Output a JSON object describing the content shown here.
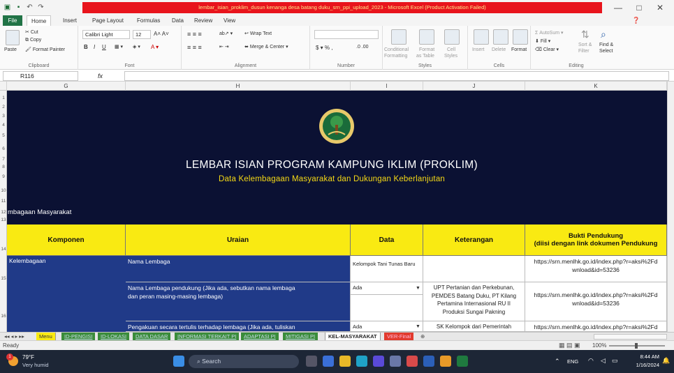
{
  "window": {
    "title": "lembar_isian_proklim_dusun kenanga desa batang duku_srn_ppi_upload_2023 - Microsoft Excel (Product Activation Failed)",
    "controls": [
      "—",
      "□",
      "✕"
    ]
  },
  "ribbon_tabs": [
    "File",
    "Home",
    "Insert",
    "Page Layout",
    "Formulas",
    "Data",
    "Review",
    "View"
  ],
  "ribbon": {
    "clipboard": {
      "paste": "Paste",
      "cut": "Cut",
      "copy": "Copy",
      "format_painter": "Format Painter",
      "label": "Clipboard"
    },
    "font": {
      "name": "Calibri Light",
      "size": "12",
      "label": "Font",
      "bold": "B",
      "italic": "I",
      "underline": "U"
    },
    "alignment": {
      "wrap": "Wrap Text",
      "merge": "Merge & Center",
      "label": "Alignment"
    },
    "number": {
      "label": "Number",
      "currency": "$",
      "percent": "%",
      "comma": ","
    },
    "styles": {
      "conditional": "Conditional",
      "conditional2": "Formatting",
      "format_as": "Format",
      "format_as2": "as Table",
      "cell": "Cell",
      "cell2": "Styles",
      "label": "Styles"
    },
    "cells": {
      "insert": "Insert",
      "delete": "Delete",
      "format": "Format",
      "label": "Cells"
    },
    "editing": {
      "autosum": "AutoSum",
      "fill": "Fill",
      "clear": "Clear",
      "sort": "Sort &",
      "sort2": "Filter",
      "find": "Find &",
      "find2": "Select",
      "label": "Editing"
    }
  },
  "formula_bar": {
    "name_box": "R116",
    "fx": "fx",
    "value": ""
  },
  "columns": [
    "G",
    "H",
    "I",
    "J",
    "K"
  ],
  "rows": [
    "1",
    "2",
    "3",
    "4",
    "5",
    "6",
    "7",
    "8",
    "9",
    "10",
    "11",
    "12",
    "13",
    "14",
    "15",
    "16"
  ],
  "sheet": {
    "title": "LEMBAR ISIAN PROGRAM KAMPUNG IKLIM (PROKLIM)",
    "subtitle": "Data Kelembagaan Masyarakat dan Dukungan Keberlanjutan",
    "section": "mbagaan Masyarakat",
    "headers": [
      "Komponen",
      "Uraian",
      "Data",
      "Keterangan",
      "Bukti Pendukung",
      "(diisi dengan link dokumen Pendukung"
    ],
    "component": "Kelembagaan",
    "rows": [
      {
        "uraian": "Nama Lembaga",
        "data": "Kelompok Tani Tunas Baru",
        "keterangan": "",
        "bukti": "https://srn.menlhk.go.id/index.php?r=aksi%2Fd",
        "bukti2": "wnload&id=53236"
      },
      {
        "uraian": "Nama Lembaga pendukung (Jika ada, sebutkan nama lembaga",
        "uraian2": "dan peran masing-masing lembaga)",
        "data": "Ada",
        "keterangan": "UPT Pertanian dan Perkebunan,",
        "keterangan2": "PEMDES Batang Duku, PT Kilang",
        "keterangan3": "Pertamina Internasional RU II",
        "keterangan4": "Produksi Sungai Pakning",
        "bukti": "https://srn.menlhk.go.id/index.php?r=aksi%2Fd",
        "bukti2": "wnload&id=53236"
      },
      {
        "uraian": "Pengakuan secara tertulis terhadap lembaga (Jika ada, tuliskan",
        "data": "Ada",
        "keterangan": "SK Kelompok dari Pemerintah",
        "bukti": "https://srn.menlhk.go.id/index.php?r=aksi%2Fd"
      }
    ]
  },
  "sheet_tabs": [
    "Menu",
    "ID-PENGISI",
    "ID-LOKASI",
    "DATA DASAR",
    "INFORMASI TERKAIT PI",
    "ADAPTASI PI",
    "MITIGASI PI",
    "KEL-MASYARAKAT",
    "VER-Final"
  ],
  "status": {
    "ready": "Ready",
    "zoom": "100%"
  },
  "taskbar": {
    "temp": "79°F",
    "weather": "Very humid",
    "search": "Search",
    "lang": "ENG",
    "time": "8:44 AM",
    "date": "1/16/2024",
    "badge": "1"
  },
  "colors": {
    "banner": "#0b1133",
    "header_yellow": "#f9ea12",
    "component_blue": "#203a88",
    "excel_green": "#217346"
  }
}
